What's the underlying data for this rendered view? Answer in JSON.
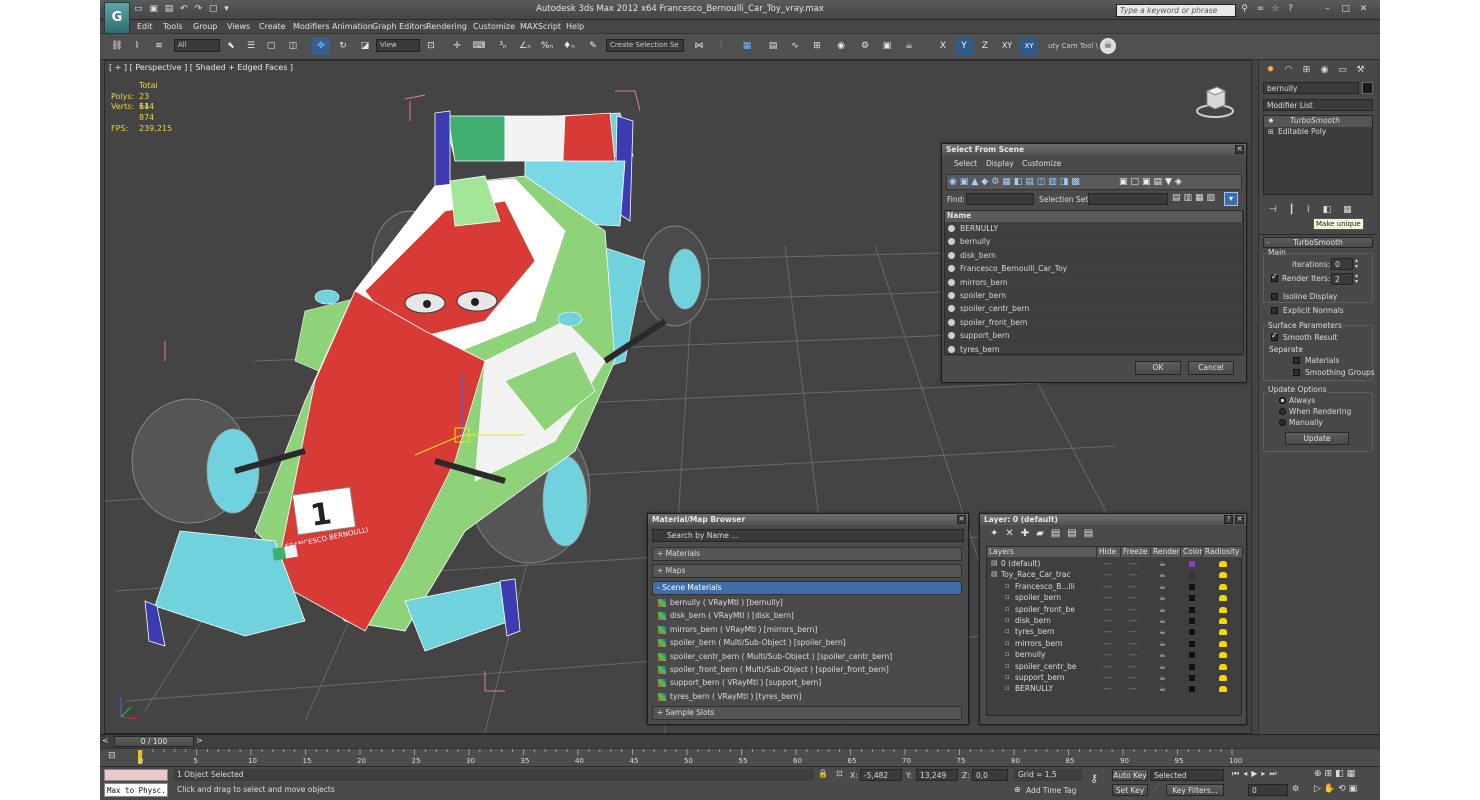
{
  "window": {
    "title": "Autodesk 3ds Max  2012 x64      Francesco_Bernoulli_Car_Toy_vray.max",
    "search_placeholder": "Type a keyword or phrase",
    "app_icon": "3ds-max-logo-icon"
  },
  "menu": [
    "Edit",
    "Tools",
    "Group",
    "Views",
    "Create",
    "Modifiers",
    "Animation",
    "Graph Editors",
    "Rendering",
    "Customize",
    "MAXScript",
    "Help"
  ],
  "toolbar": {
    "filter": "All",
    "ref_coord": "View",
    "selection_set": "Create Selection Se",
    "axes": [
      "X",
      "Y",
      "Z",
      "XY"
    ],
    "active_axis": "Y",
    "cam_tool": "uty Cam Tool \\"
  },
  "viewport": {
    "label": "[ + ] [ Perspective ] [ Shaded + Edged Faces ]",
    "stats": {
      "total_label": "Total",
      "polys_label": "Polys:",
      "polys": "23 644",
      "verts_label": "Verts:",
      "verts": "11 874",
      "fps_label": "FPS:",
      "fps": "239,215"
    },
    "car_number": "1",
    "car_text": "FRANCESCO BERNOULLI"
  },
  "select_dialog": {
    "title": "Select From Scene",
    "tabs": [
      "Select",
      "Display",
      "Customize"
    ],
    "find_label": "Find:",
    "selset_label": "Selection Set:",
    "column": "Name",
    "items": [
      "BERNULLY",
      "bernully",
      "disk_bern",
      "Francesco_Bernoulli_Car_Toy",
      "mirrors_bern",
      "spoiler_bern",
      "spoiler_centr_bern",
      "spoiler_front_bern",
      "support_bern",
      "tyres_bern"
    ],
    "ok": "OK",
    "cancel": "Cancel"
  },
  "material_browser": {
    "title": "Material/Map Browser",
    "search": "Search by Name ...",
    "sections": [
      "+ Materials",
      "+ Maps",
      "- Scene Materials",
      "+ Sample Slots"
    ],
    "items": [
      "bernully  ( VRayMtl ) [bernully]",
      "disk_bern  ( VRayMtl ) [disk_bern]",
      "mirrors_bern  ( VRayMtl ) [mirrors_bern]",
      "spoiler_bern  ( Multi/Sub-Object ) [spoiler_bern]",
      "spoiler_centr_bern  ( Multi/Sub-Object ) [spoiler_centr_bern]",
      "spoiler_front_bern  ( Multi/Sub-Object ) [spoiler_front_bern]",
      "support_bern  ( VRayMtl ) [support_bern]",
      "tyres_bern  ( VRayMtl ) [tyres_bern]"
    ]
  },
  "layer_dialog": {
    "title": "Layer: 0 (default)",
    "help": "?",
    "columns": [
      "Layers",
      "Hide",
      "Freeze",
      "Render",
      "Color",
      "Radiosity"
    ],
    "rows": [
      {
        "name": "0 (default)",
        "indent": 0,
        "color": "#8a3ec8"
      },
      {
        "name": "Toy_Race_Car_trac",
        "indent": 0,
        "color": "#333"
      },
      {
        "name": "Francesco_B...lli",
        "indent": 1,
        "color": "#111"
      },
      {
        "name": "spoiler_bern",
        "indent": 1,
        "color": "#111"
      },
      {
        "name": "spoiler_front_be",
        "indent": 1,
        "color": "#111"
      },
      {
        "name": "disk_bern",
        "indent": 1,
        "color": "#111"
      },
      {
        "name": "tyres_bern",
        "indent": 1,
        "color": "#111"
      },
      {
        "name": "mirrors_bern",
        "indent": 1,
        "color": "#111"
      },
      {
        "name": "bernully",
        "indent": 1,
        "color": "#111"
      },
      {
        "name": "spoiler_centr_be",
        "indent": 1,
        "color": "#111"
      },
      {
        "name": "support_bern",
        "indent": 1,
        "color": "#111"
      },
      {
        "name": "BERNULLY",
        "indent": 1,
        "color": "#111"
      }
    ]
  },
  "command_panel": {
    "object_name": "bernully",
    "modifier_list": "Modifier List",
    "stack": [
      "TurboSmooth",
      "Editable Poly"
    ],
    "tooltip": "Make unique",
    "rollout": "TurboSmooth",
    "main": "Main",
    "iterations_label": "Iterations:",
    "iterations": "0",
    "render_iters_label": "Render Iters:",
    "render_iters": "2",
    "isoline": "Isoline Display",
    "explicit": "Explicit Normals",
    "surface": "Surface Parameters",
    "smooth_result": "Smooth Result",
    "separate": "Separate",
    "materials": "Materials",
    "smoothing": "Smoothing Groups",
    "update_options": "Update Options",
    "always": "Always",
    "when_rendering": "When Rendering",
    "manually": "Manually",
    "update": "Update"
  },
  "timeline": {
    "frame": "0 / 100",
    "ticks": [
      "0",
      "5",
      "10",
      "15",
      "20",
      "25",
      "30",
      "35",
      "40",
      "45",
      "50",
      "55",
      "60",
      "65",
      "70",
      "75",
      "80",
      "85",
      "90",
      "95",
      "100"
    ]
  },
  "status": {
    "script": "Max to Physc.",
    "selected": "1 Object Selected",
    "prompt": "Click and drag to select and move objects",
    "x_label": "X:",
    "x": "-5,482",
    "y_label": "Y:",
    "y": "13,249",
    "z_label": "Z:",
    "z": "0,0",
    "grid": "Grid = 1,5",
    "auto_key": "Auto Key",
    "set_key": "Set Key",
    "key_mode": "Selected",
    "key_filters": "Key Filters...",
    "add_time_tag": "Add Time Tag",
    "frame_field": "0"
  }
}
